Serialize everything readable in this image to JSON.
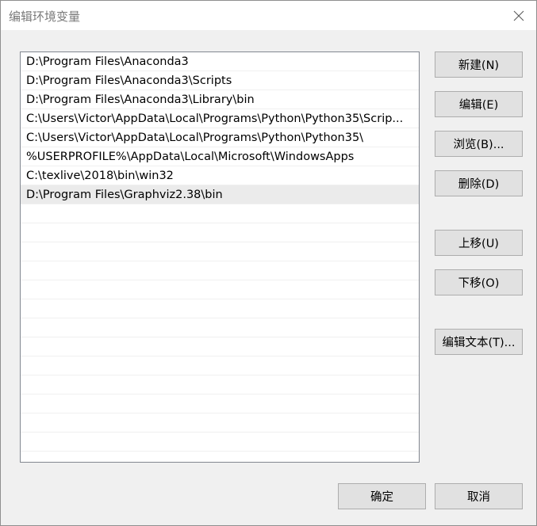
{
  "window": {
    "title": "编辑环境变量",
    "close_icon": "close-icon"
  },
  "paths": [
    {
      "value": "D:\\Program Files\\Anaconda3",
      "selected": false
    },
    {
      "value": "D:\\Program Files\\Anaconda3\\Scripts",
      "selected": false
    },
    {
      "value": "D:\\Program Files\\Anaconda3\\Library\\bin",
      "selected": false
    },
    {
      "value": "C:\\Users\\Victor\\AppData\\Local\\Programs\\Python\\Python35\\Scrip...",
      "selected": false
    },
    {
      "value": "C:\\Users\\Victor\\AppData\\Local\\Programs\\Python\\Python35\\",
      "selected": false
    },
    {
      "value": "%USERPROFILE%\\AppData\\Local\\Microsoft\\WindowsApps",
      "selected": false
    },
    {
      "value": "C:\\texlive\\2018\\bin\\win32",
      "selected": false
    },
    {
      "value": "D:\\Program Files\\Graphviz2.38\\bin",
      "selected": true
    }
  ],
  "buttons": {
    "new": "新建(N)",
    "edit": "编辑(E)",
    "browse": "浏览(B)...",
    "delete": "删除(D)",
    "move_up": "上移(U)",
    "move_down": "下移(O)",
    "edit_text": "编辑文本(T)...",
    "ok": "确定",
    "cancel": "取消"
  },
  "colors": {
    "selected_row": "#ebebeb",
    "button_face": "#e1e1e1",
    "dialog_bg": "#f0f0f0"
  }
}
